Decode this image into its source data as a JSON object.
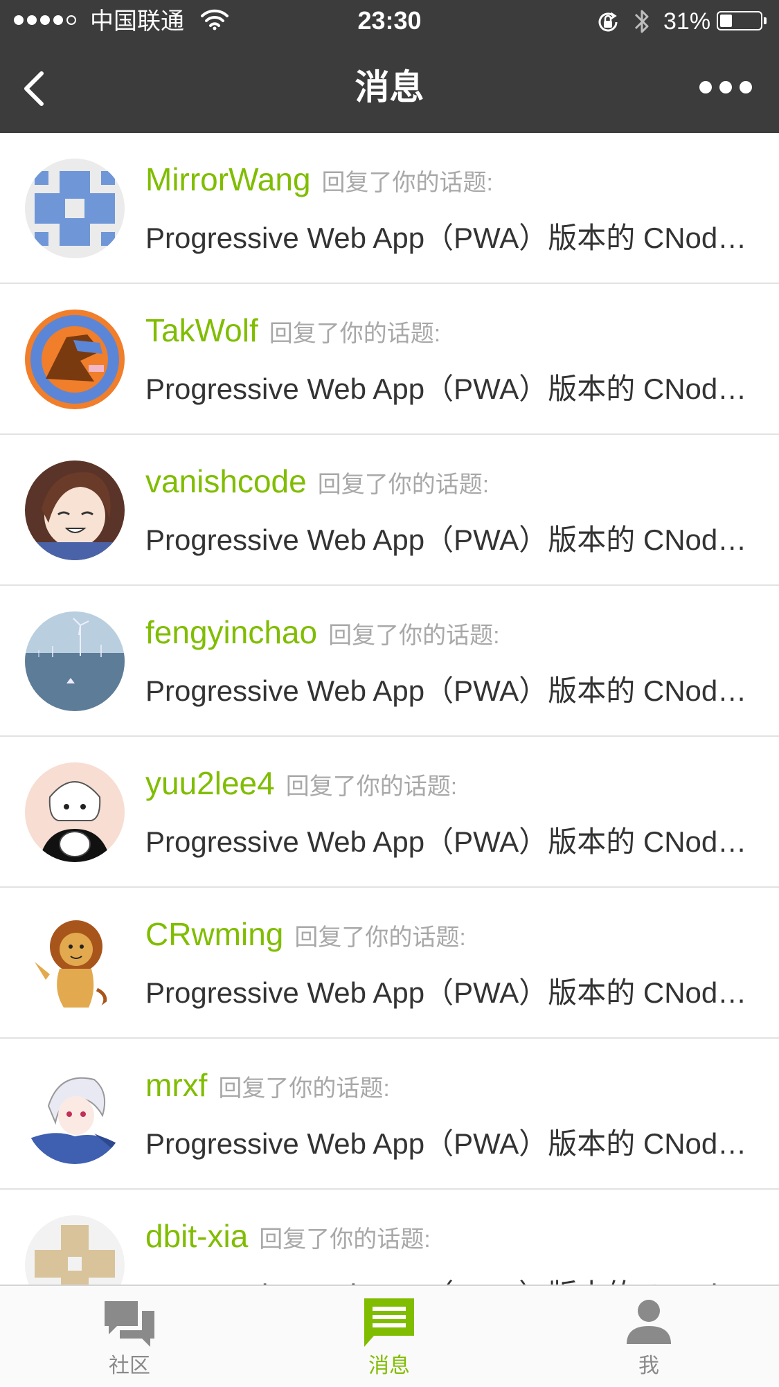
{
  "status_bar": {
    "carrier": "中国联通",
    "time": "23:30",
    "battery_percent": "31%",
    "battery_level": 0.31
  },
  "nav": {
    "title": "消息",
    "back_icon": "chevron-left-icon",
    "more_icon": "more-horizontal-icon"
  },
  "messages": [
    {
      "username": "MirrorWang",
      "action": "回复了你的话题:",
      "topic": "Progressive Web App（PWA）版本的 CNode 社区"
    },
    {
      "username": "TakWolf",
      "action": "回复了你的话题:",
      "topic": "Progressive Web App（PWA）版本的 CNode 社区"
    },
    {
      "username": "vanishcode",
      "action": "回复了你的话题:",
      "topic": "Progressive Web App（PWA）版本的 CNode 社区"
    },
    {
      "username": "fengyinchao",
      "action": "回复了你的话题:",
      "topic": "Progressive Web App（PWA）版本的 CNode 社区"
    },
    {
      "username": "yuu2lee4",
      "action": "回复了你的话题:",
      "topic": "Progressive Web App（PWA）版本的 CNode 社区"
    },
    {
      "username": "CRwming",
      "action": "回复了你的话题:",
      "topic": "Progressive Web App（PWA）版本的 CNode 社区"
    },
    {
      "username": "mrxf",
      "action": "回复了你的话题:",
      "topic": "Progressive Web App（PWA）版本的 CNode 社区"
    },
    {
      "username": "dbit-xia",
      "action": "回复了你的话题:",
      "topic": "Progressive Web App（PWA）版本的 CNode 社区"
    }
  ],
  "tabs": [
    {
      "label": "社区",
      "icon": "chat-bubbles-icon",
      "active": false
    },
    {
      "label": "消息",
      "icon": "message-icon",
      "active": true
    },
    {
      "label": "我",
      "icon": "person-icon",
      "active": false
    }
  ],
  "colors": {
    "accent": "#80bd01",
    "bar": "#3c3c3c",
    "muted": "#a8a8a8",
    "inactive_tab": "#8a8a8a"
  }
}
